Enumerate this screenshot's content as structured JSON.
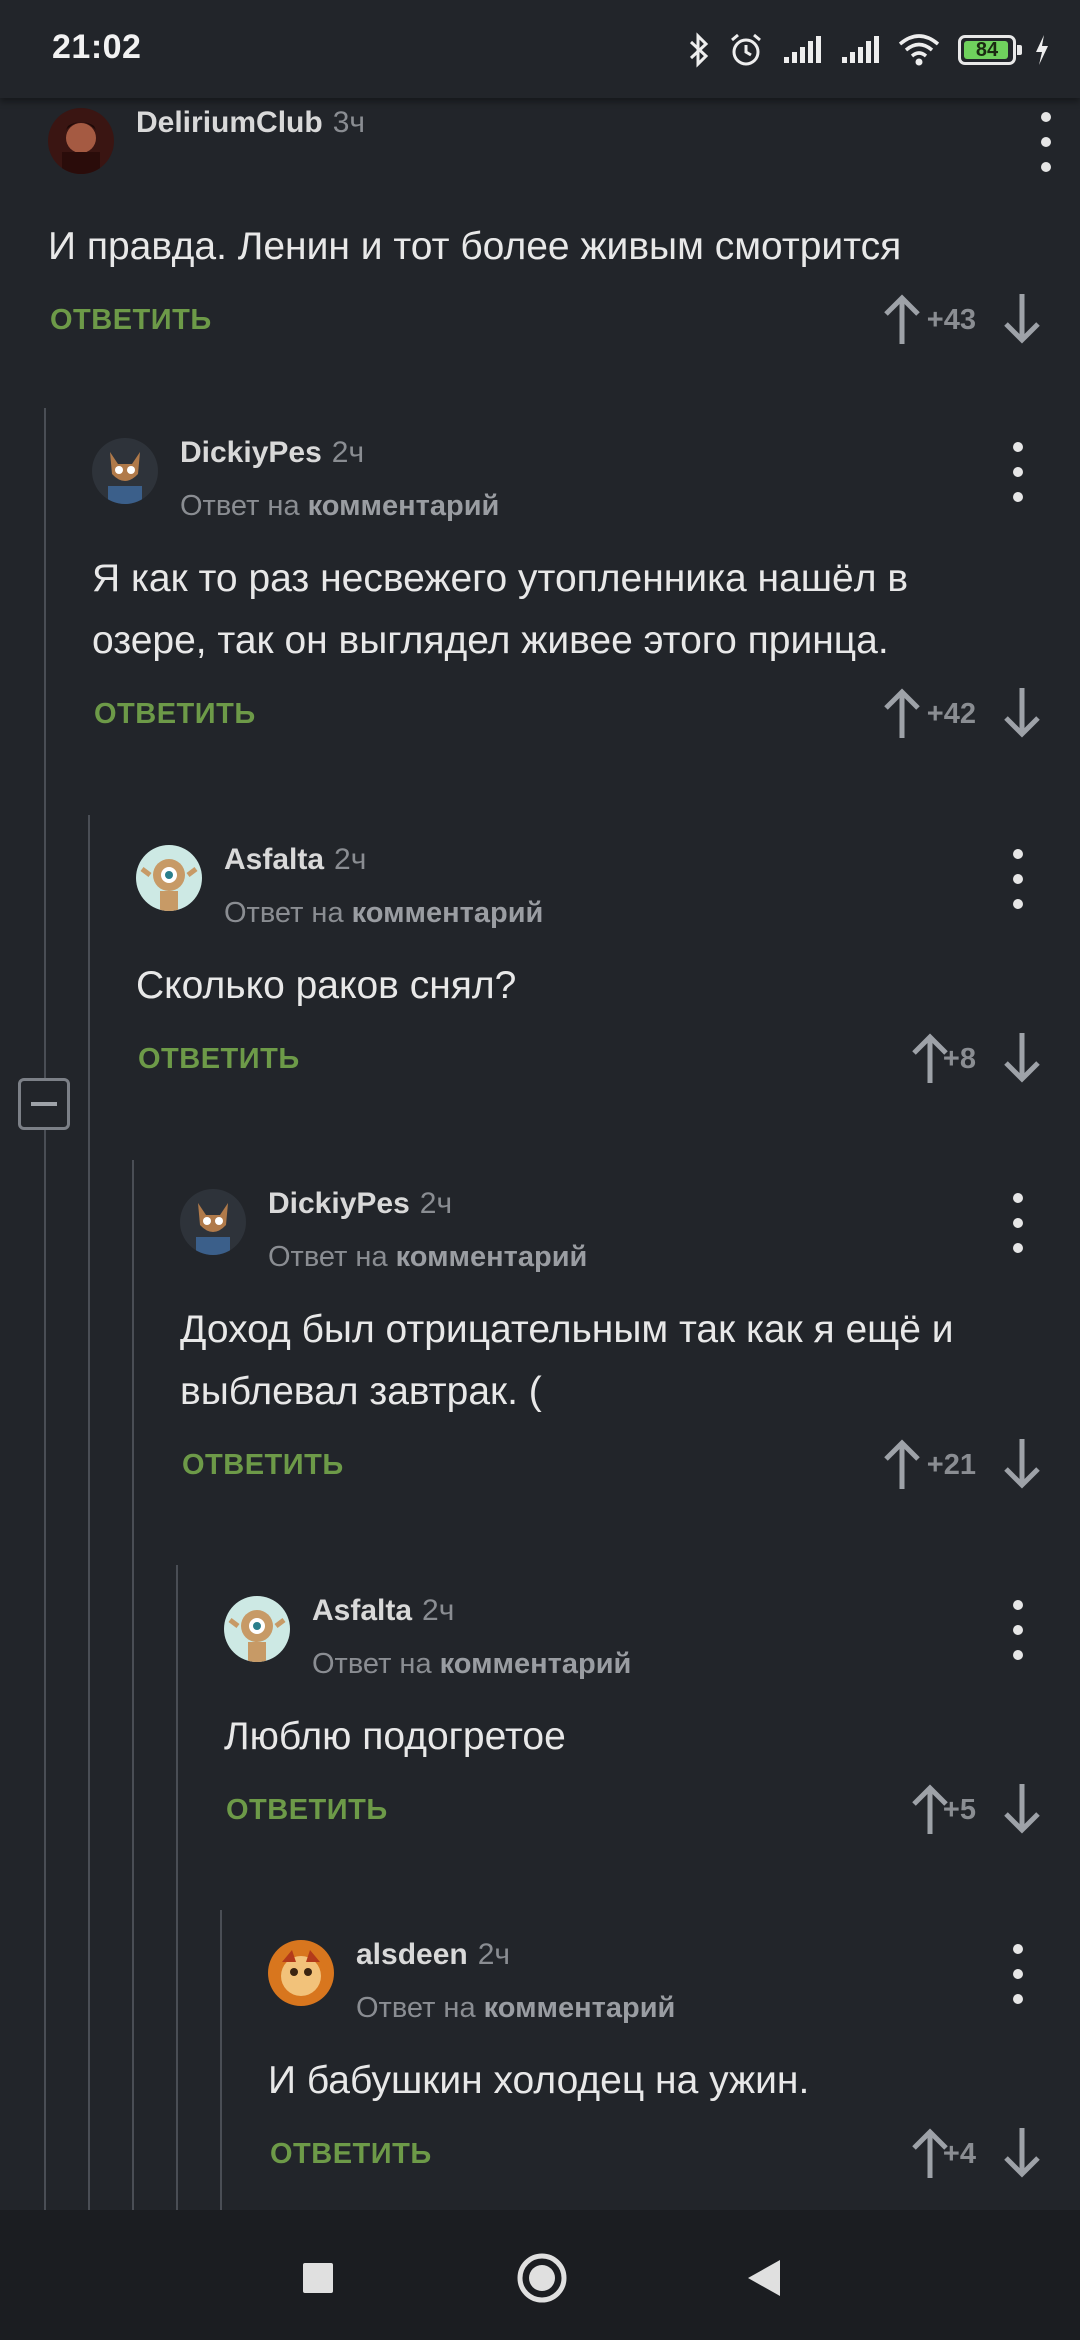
{
  "status_bar": {
    "time": "21:02",
    "battery": "84",
    "battery_level": 0.84,
    "icons": [
      "bluetooth-icon",
      "alarm-icon",
      "signal-icon",
      "signal-icon",
      "wifi-icon",
      "battery-icon",
      "charging-icon"
    ]
  },
  "colors": {
    "background": "#22252a",
    "reply_green": "#6d9a48",
    "muted": "#8a8d92",
    "text": "#e8e8e8"
  },
  "comments": [
    {
      "author": "DeliriumClub",
      "time": "3ч",
      "reply_prefix": "",
      "reply_target": "",
      "text": "И правда. Ленин и тот более живым смотрится",
      "reply_label": "ОТВЕТИТЬ",
      "score": "+43"
    },
    {
      "author": "DickiyPes",
      "time": "2ч",
      "reply_prefix": "Ответ на",
      "reply_target": "комментарий",
      "text": "Я как то раз несвежего утопленника нашёл в озере, так он выглядел живее этого принца.",
      "reply_label": "ОТВЕТИТЬ",
      "score": "+42"
    },
    {
      "author": "Asfalta",
      "time": "2ч",
      "reply_prefix": "Ответ на",
      "reply_target": "комментарий",
      "text": "Сколько раков снял?",
      "reply_label": "ОТВЕТИТЬ",
      "score": "+8"
    },
    {
      "author": "DickiyPes",
      "time": "2ч",
      "reply_prefix": "Ответ на",
      "reply_target": "комментарий",
      "text": "Доход был отрицательным так как я ещё и выблевал завтрак. (",
      "reply_label": "ОТВЕТИТЬ",
      "score": "+21"
    },
    {
      "author": "Asfalta",
      "time": "2ч",
      "reply_prefix": "Ответ на",
      "reply_target": "комментарий",
      "text": "Люблю подогретое",
      "reply_label": "ОТВЕТИТЬ",
      "score": "+5"
    },
    {
      "author": "alsdeen",
      "time": "2ч",
      "reply_prefix": "Ответ на",
      "reply_target": "комментарий",
      "text": "И бабушкин холодец на ужин.",
      "reply_label": "ОТВЕТИТЬ",
      "score": "+4"
    }
  ],
  "nav": {
    "icons": [
      "recents-square-icon",
      "home-circle-icon",
      "back-triangle-icon"
    ]
  }
}
